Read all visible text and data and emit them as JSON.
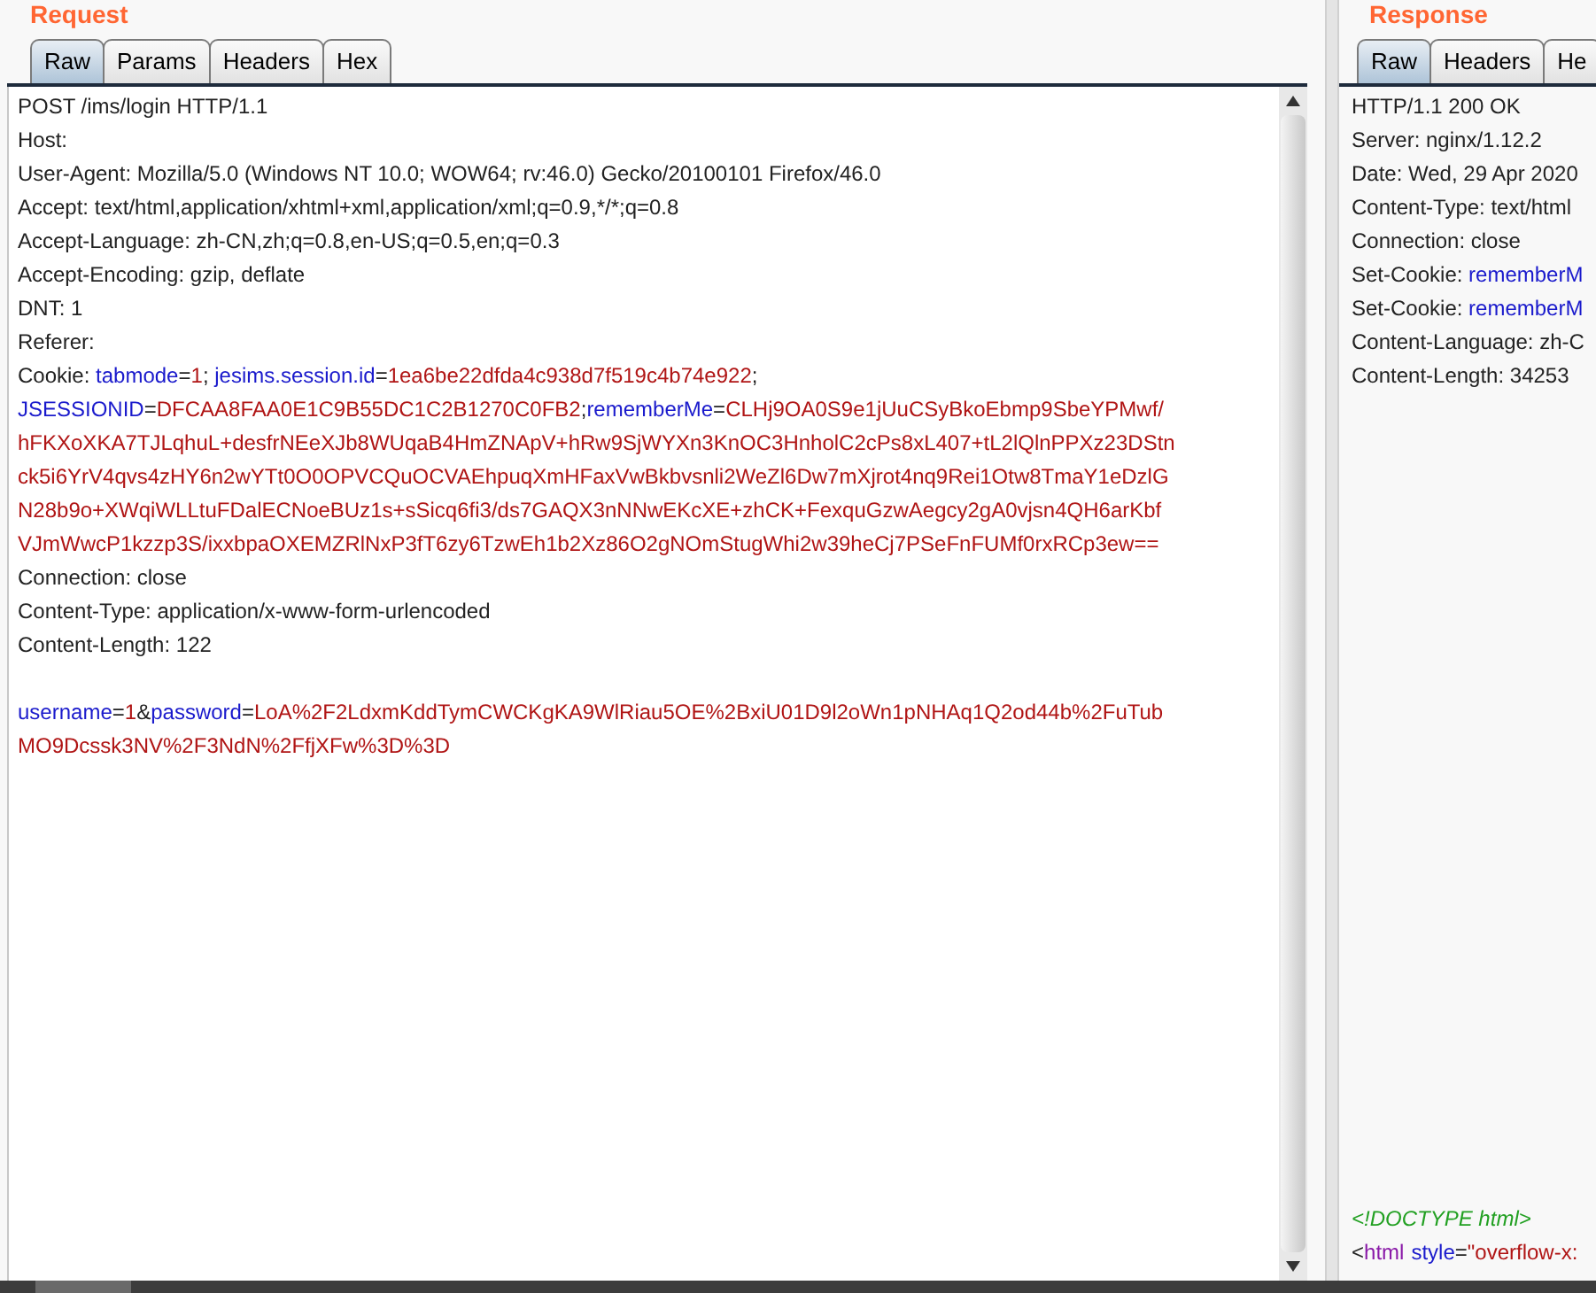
{
  "request": {
    "title": "Request",
    "tabs": [
      {
        "label": "Raw",
        "selected": true
      },
      {
        "label": "Params",
        "selected": false
      },
      {
        "label": "Headers",
        "selected": false
      },
      {
        "label": "Hex",
        "selected": false
      }
    ],
    "lines": [
      [
        {
          "kind": "plain",
          "text": "POST /ims/login HTTP/1.1"
        }
      ],
      [
        {
          "kind": "plain",
          "text": "Host:"
        }
      ],
      [
        {
          "kind": "plain",
          "text": "User-Agent: Mozilla/5.0 (Windows NT 10.0; WOW64; rv:46.0) Gecko/20100101 Firefox/46.0"
        }
      ],
      [
        {
          "kind": "plain",
          "text": "Accept: text/html,application/xhtml+xml,application/xml;q=0.9,*/*;q=0.8"
        }
      ],
      [
        {
          "kind": "plain",
          "text": "Accept-Language: zh-CN,zh;q=0.8,en-US;q=0.5,en;q=0.3"
        }
      ],
      [
        {
          "kind": "plain",
          "text": "Accept-Encoding: gzip, deflate"
        }
      ],
      [
        {
          "kind": "plain",
          "text": "DNT: 1"
        }
      ],
      [
        {
          "kind": "plain",
          "text": "Referer:"
        }
      ],
      [
        {
          "kind": "plain",
          "text": "Cookie: "
        },
        {
          "kind": "name",
          "text": "tabmode"
        },
        {
          "kind": "plain",
          "text": "="
        },
        {
          "kind": "value",
          "text": "1"
        },
        {
          "kind": "plain",
          "text": "; "
        },
        {
          "kind": "name",
          "text": "jesims.session.id"
        },
        {
          "kind": "plain",
          "text": "="
        },
        {
          "kind": "value",
          "text": "1ea6be22dfda4c938d7f519c4b74e922"
        },
        {
          "kind": "plain",
          "text": ";"
        }
      ],
      [
        {
          "kind": "name",
          "text": "JSESSIONID"
        },
        {
          "kind": "plain",
          "text": "="
        },
        {
          "kind": "value",
          "text": "DFCAA8FAA0E1C9B55DC1C2B1270C0FB2"
        },
        {
          "kind": "plain",
          "text": ";"
        },
        {
          "kind": "name",
          "text": "rememberMe"
        },
        {
          "kind": "plain",
          "text": "="
        },
        {
          "kind": "value",
          "text": "CLHj9OA0S9e1jUuCSyBkoEbmp9SbeYPMwf/"
        }
      ],
      [
        {
          "kind": "value",
          "text": "hFKXoXKA7TJLqhuL+desfrNEeXJb8WUqaB4HmZNApV+hRw9SjWYXn3KnOC3HnholC2cPs8xL407+tL2lQlnPPXz23DStn"
        }
      ],
      [
        {
          "kind": "value",
          "text": "ck5i6YrV4qvs4zHY6n2wYTt0O0OPVCQuOCVAEhpuqXmHFaxVwBkbvsnli2WeZl6Dw7mXjrot4nq9Rei1Otw8TmaY1eDzlG"
        }
      ],
      [
        {
          "kind": "value",
          "text": "N28b9o+XWqiWLLtuFDalECNoeBUz1s+sSicq6fi3/ds7GAQX3nNNwEKcXE+zhCK+FexquGzwAegcy2gA0vjsn4QH6arKbf"
        }
      ],
      [
        {
          "kind": "value",
          "text": "VJmWwcP1kzzp3S/ixxbpaOXEMZRlNxP3fT6zy6TzwEh1b2Xz86O2gNOmStugWhi2w39heCj7PSeFnFUMf0rxRCp3ew=="
        }
      ],
      [
        {
          "kind": "plain",
          "text": "Connection: close"
        }
      ],
      [
        {
          "kind": "plain",
          "text": "Content-Type: application/x-www-form-urlencoded"
        }
      ],
      [
        {
          "kind": "plain",
          "text": "Content-Length: 122"
        }
      ],
      {
        "gap_before": true,
        "segments": [
          {
            "kind": "name",
            "text": "username"
          },
          {
            "kind": "plain",
            "text": "="
          },
          {
            "kind": "value",
            "text": "1"
          },
          {
            "kind": "plain",
            "text": "&"
          },
          {
            "kind": "name",
            "text": "password"
          },
          {
            "kind": "plain",
            "text": "="
          },
          {
            "kind": "value",
            "text": "LoA%2F2LdxmKddTymCWCKgKA9WlRiau5OE%2BxiU01D9l2oWn1pNHAq1Q2od44b%2FuTub"
          }
        ]
      },
      [
        {
          "kind": "value",
          "text": "MO9Dcssk3NV%2F3NdN%2FfjXFw%3D%3D"
        }
      ]
    ]
  },
  "response": {
    "title": "Response",
    "tabs": [
      {
        "label": "Raw",
        "selected": true
      },
      {
        "label": "Headers",
        "selected": false
      },
      {
        "label": "He",
        "selected": false
      }
    ],
    "lines": [
      [
        {
          "kind": "plain",
          "text": "HTTP/1.1 200 OK"
        }
      ],
      [
        {
          "kind": "plain",
          "text": "Server: nginx/1.12.2"
        }
      ],
      [
        {
          "kind": "plain",
          "text": "Date: Wed, 29 Apr 2020"
        }
      ],
      [
        {
          "kind": "plain",
          "text": "Content-Type: text/html"
        }
      ],
      [
        {
          "kind": "plain",
          "text": "Connection: close"
        }
      ],
      [
        {
          "kind": "plain",
          "text": "Set-Cookie: "
        },
        {
          "kind": "name",
          "text": "rememberM"
        }
      ],
      [
        {
          "kind": "plain",
          "text": "Set-Cookie: "
        },
        {
          "kind": "name",
          "text": "rememberM"
        }
      ],
      [
        {
          "kind": "plain",
          "text": "Content-Language: zh-C"
        }
      ],
      [
        {
          "kind": "plain",
          "text": "Content-Length: 34253"
        }
      ]
    ],
    "body_lines": [
      [
        {
          "kind": "doctype",
          "text": "<!DOCTYPE html>"
        }
      ],
      [
        {
          "kind": "plain",
          "text": "<"
        },
        {
          "kind": "tag",
          "text": "html"
        },
        {
          "kind": "attr",
          "text": "style"
        },
        {
          "kind": "plain",
          "text": "="
        },
        {
          "kind": "value",
          "text": "\"overflow-x:"
        }
      ]
    ]
  }
}
